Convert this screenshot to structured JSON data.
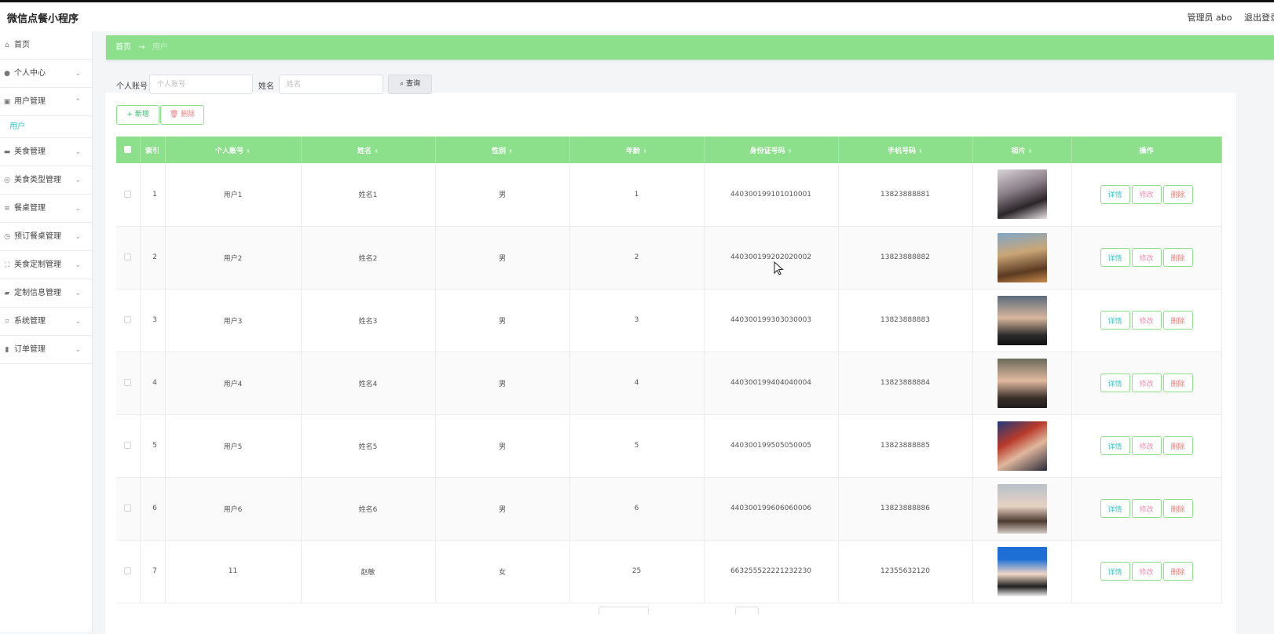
{
  "header": {
    "app_title": "微信点餐小程序",
    "user_label": "管理员 abo",
    "logout_label": "退出登录"
  },
  "sidebar": {
    "items": [
      {
        "label": "首页",
        "icon": "home-icon",
        "chevron": ""
      },
      {
        "label": "个人中心",
        "icon": "user-icon",
        "chevron": "⌄"
      },
      {
        "label": "用户管理",
        "icon": "users-icon",
        "chevron": "⌃"
      },
      {
        "label": "美食管理",
        "icon": "chat-icon",
        "chevron": "⌄"
      },
      {
        "label": "美食类型管理",
        "icon": "info-icon",
        "chevron": "⌄"
      },
      {
        "label": "餐桌管理",
        "icon": "sliders-icon",
        "chevron": "⌄"
      },
      {
        "label": "预订餐桌管理",
        "icon": "clock-icon",
        "chevron": "⌄"
      },
      {
        "label": "美食定制管理",
        "icon": "fullscreen-icon",
        "chevron": "⌄"
      },
      {
        "label": "定制信息管理",
        "icon": "ticket-icon",
        "chevron": "⌄"
      },
      {
        "label": "系统管理",
        "icon": "crop-icon",
        "chevron": "⌄"
      },
      {
        "label": "订单管理",
        "icon": "bar-chart-icon",
        "chevron": "⌄"
      }
    ],
    "sub_item": "用户"
  },
  "breadcrumb": {
    "home": "首页",
    "separator": "→",
    "current": "用户"
  },
  "search": {
    "account_label": "个人账号",
    "account_placeholder": "个人账号",
    "name_label": "姓名",
    "name_placeholder": "姓名",
    "query_label": "查询"
  },
  "actions": {
    "add_label": "新增",
    "delete_label": "删除"
  },
  "table": {
    "headers": {
      "index": "索引",
      "account": "个人账号",
      "name": "姓名",
      "gender": "性别",
      "age": "年龄",
      "id_card": "身份证号码",
      "phone": "手机号码",
      "photo": "相片",
      "ops": "操作"
    },
    "rows": [
      {
        "index": "1",
        "account": "用户1",
        "name": "姓名1",
        "gender": "男",
        "age": "1",
        "id_card": "440300199101010001",
        "phone": "13823888881"
      },
      {
        "index": "2",
        "account": "用户2",
        "name": "姓名2",
        "gender": "男",
        "age": "2",
        "id_card": "440300199202020002",
        "phone": "13823888882"
      },
      {
        "index": "3",
        "account": "用户3",
        "name": "姓名3",
        "gender": "男",
        "age": "3",
        "id_card": "440300199303030003",
        "phone": "13823888883"
      },
      {
        "index": "4",
        "account": "用户4",
        "name": "姓名4",
        "gender": "男",
        "age": "4",
        "id_card": "440300199404040004",
        "phone": "13823888884"
      },
      {
        "index": "5",
        "account": "用户5",
        "name": "姓名5",
        "gender": "男",
        "age": "5",
        "id_card": "440300199505050005",
        "phone": "13823888885"
      },
      {
        "index": "6",
        "account": "用户6",
        "name": "姓名6",
        "gender": "男",
        "age": "6",
        "id_card": "440300199606060006",
        "phone": "13823888886"
      },
      {
        "index": "7",
        "account": "11",
        "name": "赵敏",
        "gender": "女",
        "age": "25",
        "id_card": "663255522221232230",
        "phone": "12355632120"
      }
    ],
    "row_actions": {
      "detail": "详情",
      "edit": "修改",
      "delete": "删除"
    }
  },
  "colors": {
    "accent": "#8ce08c",
    "detail": "#3bc4c9",
    "edit": "#e98fb0",
    "delete": "#f07a7a"
  }
}
